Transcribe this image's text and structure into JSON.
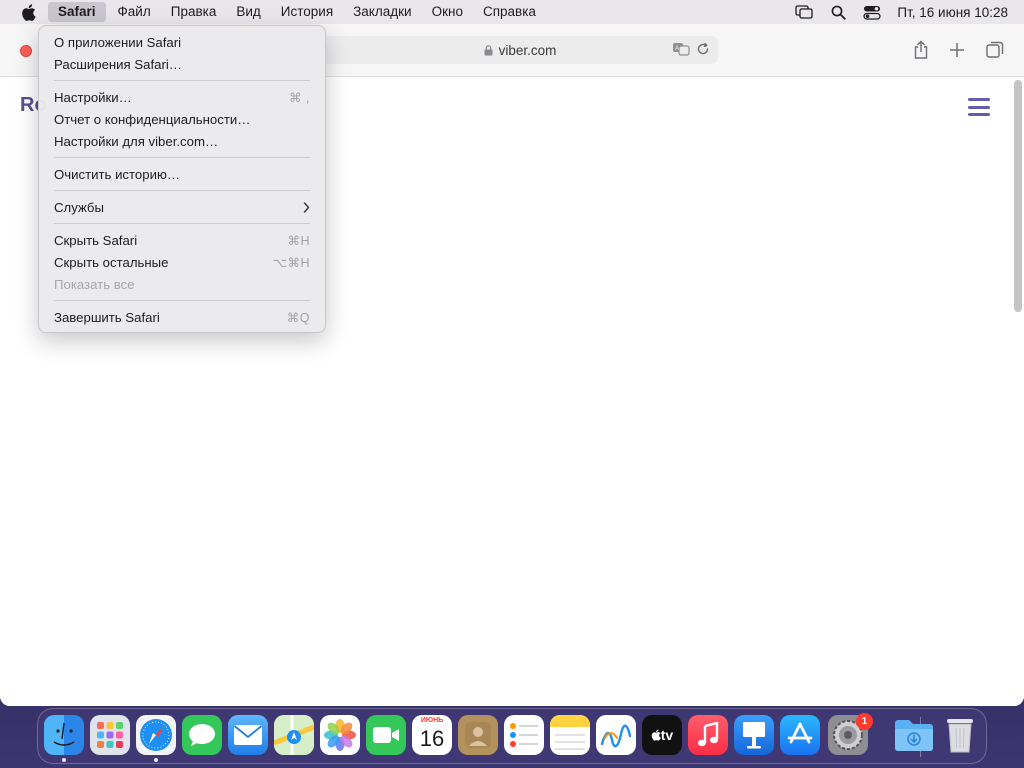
{
  "menubar": {
    "app_name": "Safari",
    "menus": [
      "Файл",
      "Правка",
      "Вид",
      "История",
      "Закладки",
      "Окно",
      "Справка"
    ],
    "clock": "Пт, 16 июня  10:28"
  },
  "browser": {
    "url": "viber.com",
    "site_logo_fragment": "Ro"
  },
  "safari_menu": {
    "about": "О приложении Safari",
    "extensions": "Расширения Safari…",
    "settings": "Настройки…",
    "settings_shortcut": "⌘ ,",
    "privacy_report": "Отчет о конфиденциальности…",
    "site_settings": "Настройки для viber.com…",
    "clear_history": "Очистить историю…",
    "services": "Службы",
    "hide_safari": "Скрыть Safari",
    "hide_safari_shortcut": "⌘H",
    "hide_others": "Скрыть остальные",
    "hide_others_shortcut": "⌥⌘H",
    "show_all": "Показать все",
    "quit": "Завершить Safari",
    "quit_shortcut": "⌘Q"
  },
  "dock": {
    "calendar_month": "ИЮНЬ",
    "calendar_day": "16",
    "tv_label": "tv",
    "settings_badge": "1"
  },
  "colors": {
    "accent_purple": "#665cac",
    "close_red": "#fe5f57",
    "badge_red": "#ff3b30"
  }
}
